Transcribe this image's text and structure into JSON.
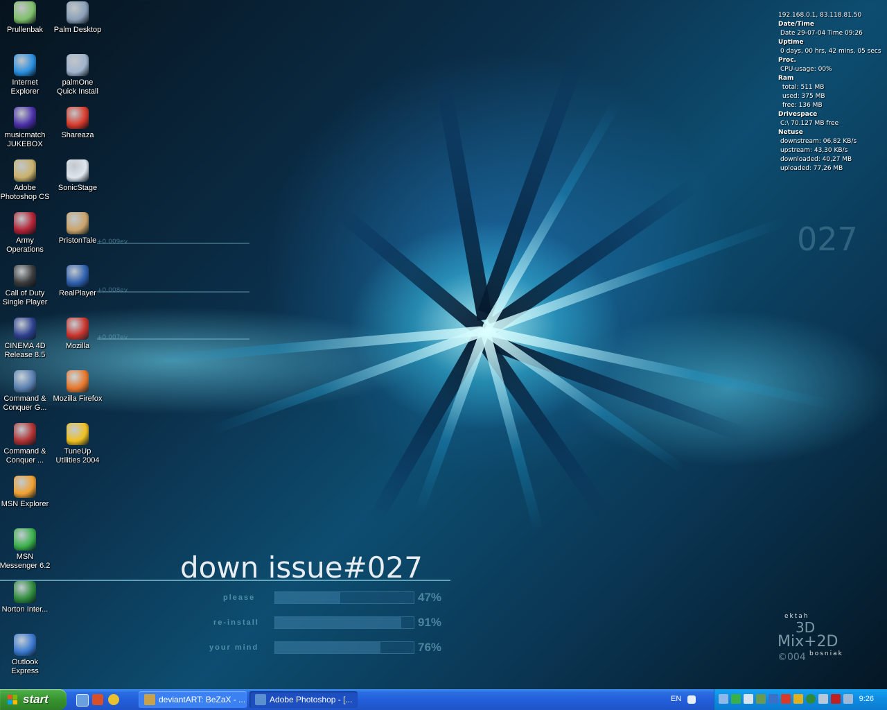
{
  "desktop": {
    "icons": [
      {
        "label": "Prullenbak",
        "icon": "recycle-bin-icon",
        "color": "#7fbf6a"
      },
      {
        "label": "Palm Desktop",
        "icon": "palm-desktop-icon",
        "color": "#8aa0b8"
      },
      {
        "label": "Internet Explorer",
        "icon": "internet-explorer-icon",
        "color": "#2a8fe0"
      },
      {
        "label": "palmOne Quick Install",
        "icon": "palmone-install-icon",
        "color": "#9fb4cc"
      },
      {
        "label": "musicmatch JUKEBOX",
        "icon": "musicmatch-icon",
        "color": "#4a2fa8"
      },
      {
        "label": "Shareaza",
        "icon": "shareaza-icon",
        "color": "#d83a2a"
      },
      {
        "label": "Adobe Photoshop CS",
        "icon": "photoshop-icon",
        "color": "#c9b16a"
      },
      {
        "label": "SonicStage",
        "icon": "sonicstage-icon",
        "color": "#dfe6ee"
      },
      {
        "label": "Army Operations",
        "icon": "army-operations-icon",
        "color": "#b22234"
      },
      {
        "label": "PristonTale",
        "icon": "pristontale-icon",
        "color": "#caa36a"
      },
      {
        "label": "Call of Duty Single Player",
        "icon": "call-of-duty-icon",
        "color": "#3a3a3a"
      },
      {
        "label": "RealPlayer",
        "icon": "realplayer-icon",
        "color": "#2f5fae"
      },
      {
        "label": "CINEMA 4D Release 8.5",
        "icon": "cinema4d-icon",
        "color": "#2d3f8f"
      },
      {
        "label": "Mozilla",
        "icon": "mozilla-icon",
        "color": "#c8322a"
      },
      {
        "label": "Command & Conquer G...",
        "icon": "command-conquer-generals-icon",
        "color": "#5a7fb0"
      },
      {
        "label": "Mozilla Firefox",
        "icon": "firefox-icon",
        "color": "#e8762a"
      },
      {
        "label": "Command & Conquer ...",
        "icon": "command-conquer-icon",
        "color": "#b03030"
      },
      {
        "label": "TuneUp Utilities 2004",
        "icon": "tuneup-icon",
        "color": "#f0c020"
      },
      {
        "label": "MSN Explorer",
        "icon": "msn-explorer-icon",
        "color": "#f0a030"
      },
      {
        "label": "MSN Messenger 6.2",
        "icon": "msn-messenger-icon",
        "color": "#3ab04a"
      },
      {
        "label": "Norton Inter...",
        "icon": "norton-globe-icon",
        "color": "#2e8a3a"
      },
      {
        "label": "Outlook Express",
        "icon": "outlook-express-icon",
        "color": "#3a78d0"
      }
    ]
  },
  "sysmon": {
    "ip": "192.168.0.1, 83.118.81.50",
    "datetime_header": "Date/Time",
    "datetime": "Date 29-07-04 Time 09:26",
    "uptime_header": "Uptime",
    "uptime": "0 days, 00 hrs, 42 mins, 05 secs",
    "proc_header": "Proc.",
    "cpu": "CPU-usage: 00%",
    "ram_header": "Ram",
    "ram_total": "total: 511 MB",
    "ram_used": "used: 375 MB",
    "ram_free": "free: 136 MB",
    "drive_header": "Drivespace",
    "drive": "C:\\ 70.127 MB free",
    "net_header": "Netuse",
    "downstream": "downstream: 06,82 KB/s",
    "upstream": "upstream: 43,30 KB/s",
    "downloaded": "downloaded: 40,27 MB",
    "uploaded": "uploaded: 77,26 MB"
  },
  "wallpaper": {
    "title": "down issue#027",
    "bars": [
      {
        "label": "please",
        "percent_text": "47%",
        "fill": 0.47
      },
      {
        "label": "re-install",
        "percent_text": "91%",
        "fill": 0.91
      },
      {
        "label": "your mind",
        "percent_text": "76%",
        "fill": 0.76
      }
    ],
    "sig_top": "ektah",
    "sig_main_1": "3D",
    "sig_main_2": "Mix+2D",
    "sig_bottom": "bosniak",
    "sig_year": "©004",
    "side_number": "027",
    "ev_labels": [
      "+0.009ev",
      "+0.008ev",
      "+0.007ev"
    ]
  },
  "taskbar": {
    "start_label": "start",
    "quick_launch": [
      "show-desktop-icon",
      "media-icon",
      "winamp-icon"
    ],
    "tasks": [
      {
        "label": "deviantART: BeZaX - ...",
        "icon": "deviantart-icon",
        "color": "#c8a24a"
      },
      {
        "label": "Adobe Photoshop - [...",
        "icon": "photoshop-task-icon",
        "color": "#5a8fd0"
      }
    ],
    "language": "EN",
    "tray_icons": [
      "network-icon",
      "messenger-tray-icon",
      "volume-icon",
      "user-icon",
      "update-icon",
      "shareaza-tray-icon",
      "firewall-icon",
      "norton-tray-icon",
      "antivirus-tray-icon",
      "ati-icon",
      "safely-remove-icon"
    ],
    "clock": "9:26"
  }
}
